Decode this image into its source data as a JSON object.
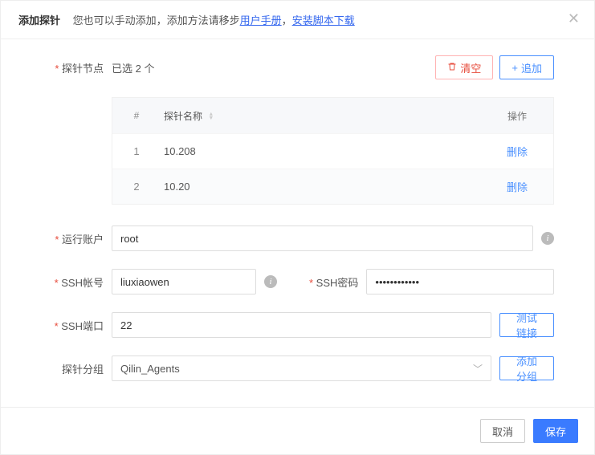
{
  "header": {
    "title": "添加探针",
    "hint_prefix": "您也可以手动添加，添加方法请移步",
    "link_manual": "用户手册",
    "hint_sep": "，",
    "link_download": "安装脚本下载"
  },
  "probe": {
    "label": "探针节点",
    "selected_text": "已选 2 个",
    "clear_btn": "清空",
    "add_btn": "追加"
  },
  "table": {
    "col_idx": "#",
    "col_name": "探针名称",
    "col_op": "操作",
    "rows": [
      {
        "idx": "1",
        "name": "10.208",
        "op": "删除"
      },
      {
        "idx": "2",
        "name": "10.20",
        "op": "删除"
      }
    ]
  },
  "account": {
    "label": "运行账户",
    "value": "root"
  },
  "ssh_user": {
    "label": "SSH帐号",
    "value": "liuxiaowen"
  },
  "ssh_pwd": {
    "label": "SSH密码",
    "value": "••••••••••••"
  },
  "ssh_port": {
    "label": "SSH端口",
    "value": "22",
    "test_btn": "测试链接"
  },
  "group": {
    "label": "探针分组",
    "value": "Qilin_Agents",
    "add_btn": "添加分组"
  },
  "footer": {
    "cancel": "取消",
    "save": "保存"
  }
}
